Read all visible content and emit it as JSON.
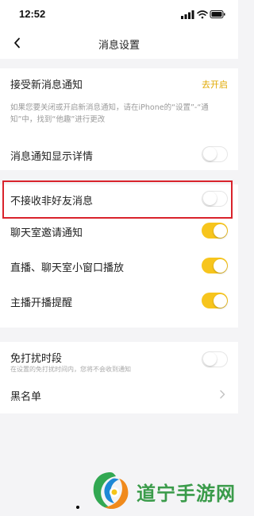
{
  "status_bar": {
    "time": "12:52"
  },
  "header": {
    "title": "消息设置"
  },
  "notifications": {
    "label": "接受新消息通知",
    "action": "去开启",
    "hint": "如果您要关闭或开启新消息通知，请在iPhone的“设置”-“通知”中，找到“他趣”进行更改"
  },
  "settings": [
    {
      "label": "消息通知显示详情",
      "state": "off"
    },
    {
      "label": "不接收非好友消息",
      "state": "off"
    },
    {
      "label": "聊天室邀请通知",
      "state": "on"
    },
    {
      "label": "直播、聊天室小窗口播放",
      "state": "on"
    },
    {
      "label": "主播开播提醒",
      "state": "on"
    }
  ],
  "dnd": {
    "label": "免打扰时段",
    "sub": "在设置的免打扰时间内，您将不会收到通知",
    "state": "off"
  },
  "blacklist": {
    "label": "黑名单"
  },
  "watermark": {
    "text": "道宁手游网"
  },
  "colors": {
    "toggle_on": "#f7c51d",
    "accent_text": "#e0a800",
    "highlight": "#d9232c",
    "watermark": "#3a9b4a"
  }
}
